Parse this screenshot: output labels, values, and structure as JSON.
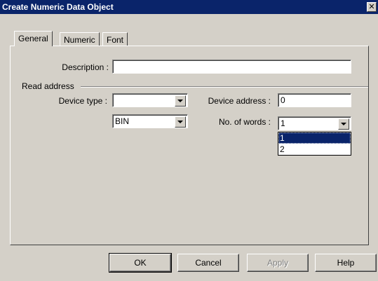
{
  "window": {
    "title": "Create Numeric Data Object",
    "close_glyph": "✕"
  },
  "tabs": [
    {
      "label": "General",
      "active": true
    },
    {
      "label": "Numeric",
      "active": false
    },
    {
      "label": "Font",
      "active": false
    }
  ],
  "general": {
    "description_label": "Description :",
    "description_value": "",
    "read_address_group": "Read address",
    "device_type_label": "Device type :",
    "device_type_value": "",
    "format_value": "BIN",
    "device_address_label": "Device address :",
    "device_address_value": "0",
    "no_of_words_label": "No. of words :",
    "no_of_words_value": "1",
    "no_of_words_options": [
      "1",
      "2"
    ],
    "no_of_words_selected": "1"
  },
  "buttons": {
    "ok": "OK",
    "cancel": "Cancel",
    "apply": "Apply",
    "help": "Help"
  },
  "colors": {
    "titlebar": "#0a246a",
    "face": "#d4d0c8",
    "selection": "#0a246a"
  }
}
